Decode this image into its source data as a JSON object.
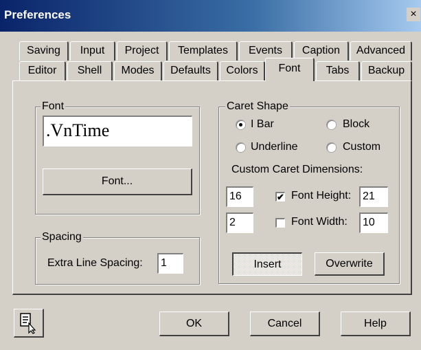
{
  "window": {
    "title": "Preferences",
    "close_glyph": "×"
  },
  "tabs_back": [
    "Saving",
    "Input",
    "Project",
    "Templates",
    "Events",
    "Caption",
    "Advanced"
  ],
  "tabs_front": [
    "Editor",
    "Shell",
    "Modes",
    "Defaults",
    "Colors",
    "Font",
    "Tabs",
    "Backup"
  ],
  "active_tab": "Font",
  "font_group": {
    "legend": "Font",
    "current_font": ".VnTime",
    "font_button": "Font..."
  },
  "spacing_group": {
    "legend": "Spacing",
    "extra_label": "Extra Line Spacing:",
    "extra_value": "1"
  },
  "caret_group": {
    "legend": "Caret Shape",
    "opt_ibar": "I Bar",
    "opt_block": "Block",
    "opt_underline": "Underline",
    "opt_custom": "Custom",
    "selected": "I Bar",
    "dims_label": "Custom Caret Dimensions:",
    "height_value_left": "16",
    "height_label": "Font Height:",
    "height_value_right": "21",
    "height_checked": true,
    "width_value_left": "2",
    "width_label": "Font Width:",
    "width_value_right": "10",
    "width_checked": false,
    "insert_label": "Insert",
    "overwrite_label": "Overwrite"
  },
  "footer": {
    "ok": "OK",
    "cancel": "Cancel",
    "help": "Help",
    "help_icon": "help-cursor-icon"
  }
}
